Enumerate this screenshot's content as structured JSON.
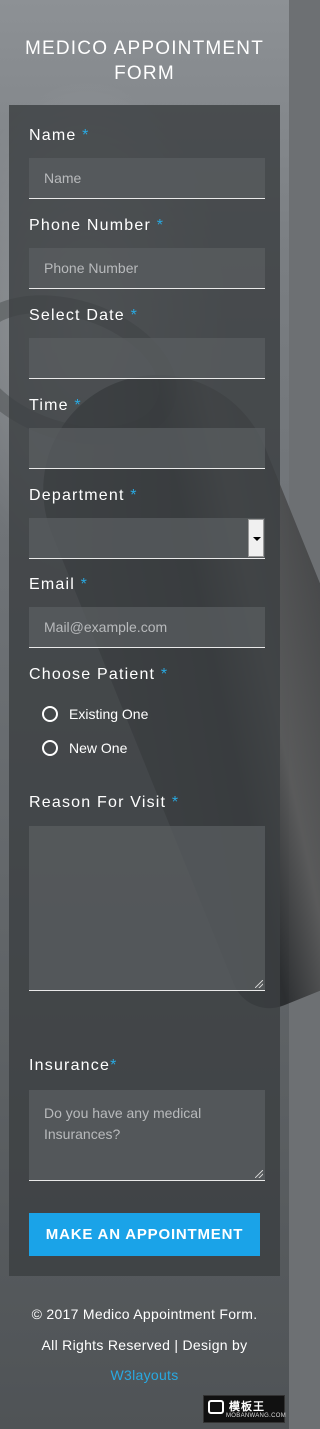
{
  "title": "MEDICO APPOINTMENT FORM",
  "required_marker": "*",
  "fields": {
    "name": {
      "label": "Name",
      "placeholder": "Name"
    },
    "phone": {
      "label": "Phone Number",
      "placeholder": "Phone Number"
    },
    "date": {
      "label": "Select Date",
      "value": ""
    },
    "time": {
      "label": "Time",
      "value": ""
    },
    "department": {
      "label": "Department",
      "selected": ""
    },
    "email": {
      "label": "Email",
      "placeholder": "Mail@example.com"
    },
    "patient": {
      "label": "Choose Patient",
      "options": [
        "Existing One",
        "New One"
      ]
    },
    "reason": {
      "label": "Reason For Visit",
      "value": ""
    },
    "insurance": {
      "label": "Insurance",
      "placeholder": "Do you have any medical Insurances?"
    }
  },
  "submit_label": "MAKE AN APPOINTMENT",
  "footer": {
    "line1": "© 2017 Medico Appointment Form.",
    "line2": "All Rights Reserved | Design by",
    "link": "W3layouts"
  },
  "watermark": {
    "cn": "模板王",
    "en": "MOBANWANG.COM"
  },
  "colors": {
    "accent": "#1aa3e8",
    "required": "#29a9e1"
  }
}
